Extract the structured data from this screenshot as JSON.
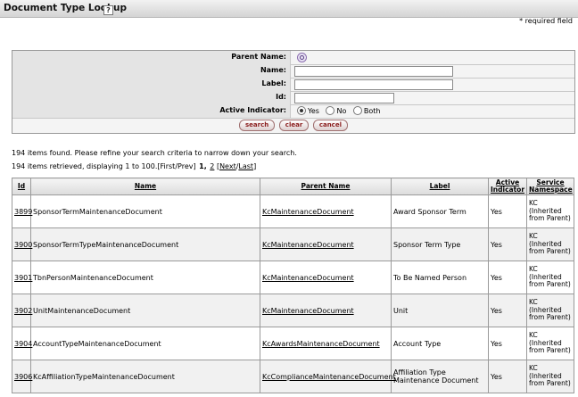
{
  "header": {
    "title": "Document Type Lookup",
    "help": "?"
  },
  "required_note": "* required field",
  "form": {
    "parent_name_label": "Parent Name:",
    "name_label": "Name:",
    "label_label": "Label:",
    "id_label": "Id:",
    "active_label": "Active Indicator:",
    "name_value": "",
    "label_value": "",
    "id_value": "",
    "active_options": [
      "Yes",
      "No",
      "Both"
    ],
    "active_selected": "Yes"
  },
  "buttons": {
    "search": "search",
    "clear": "clear",
    "cancel": "cancel"
  },
  "results": {
    "found_text": "194 items found. Please refine your search criteria to narrow down your search.",
    "retrieved_text": "194 items retrieved, displaying 1 to 100.[First/Prev]",
    "page_current": "1,",
    "page_2": "2",
    "next_last_open": "[",
    "next": "Next",
    "sep": "/",
    "last": "Last",
    "next_last_close": "]"
  },
  "table": {
    "headers": {
      "id": "Id",
      "name": "Name",
      "parent_name": "Parent Name",
      "label": "Label",
      "active_indicator": "Active Indicator",
      "service_namespace": "Service Namespace"
    },
    "rows": [
      {
        "id": "3899",
        "name": "SponsorTermMaintenanceDocument",
        "parent": "KcMaintenanceDocument",
        "label": "Award Sponsor Term",
        "active": "Yes",
        "namespace": "KC (Inherited from Parent)"
      },
      {
        "id": "3900",
        "name": "SponsorTermTypeMaintenanceDocument",
        "parent": "KcMaintenanceDocument",
        "label": "Sponsor Term Type",
        "active": "Yes",
        "namespace": "KC (Inherited from Parent)"
      },
      {
        "id": "3901",
        "name": "TbnPersonMaintenanceDocument",
        "parent": "KcMaintenanceDocument",
        "label": "To Be Named Person",
        "active": "Yes",
        "namespace": "KC (Inherited from Parent)"
      },
      {
        "id": "3902",
        "name": "UnitMaintenanceDocument",
        "parent": "KcMaintenanceDocument",
        "label": "Unit",
        "active": "Yes",
        "namespace": "KC (Inherited from Parent)"
      },
      {
        "id": "3904",
        "name": "AccountTypeMaintenanceDocument",
        "parent": "KcAwardsMaintenanceDocument",
        "label": "Account Type",
        "active": "Yes",
        "namespace": "KC (Inherited from Parent)"
      },
      {
        "id": "3906",
        "name": "KcAffiliationTypeMaintenanceDocument",
        "parent": "KcComplianceMaintenanceDocument",
        "label": "Affiliation Type Maintenance Document",
        "active": "Yes",
        "namespace": "KC (Inherited from Parent)"
      }
    ]
  }
}
